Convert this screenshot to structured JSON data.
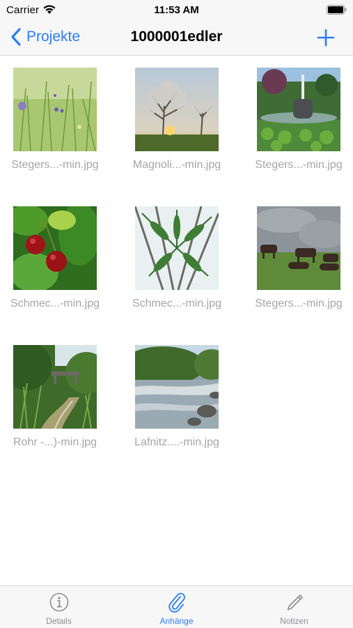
{
  "status_bar": {
    "carrier": "Carrier",
    "time": "11:53 AM"
  },
  "nav": {
    "back_label": "Projekte",
    "title": "1000001edler"
  },
  "attachments": [
    {
      "caption": "Stegers...-min.jpg",
      "image": "meadow-wildflowers"
    },
    {
      "caption": "Magnoli...-min.jpg",
      "image": "trees-sunset"
    },
    {
      "caption": "Stegers...-min.jpg",
      "image": "park-fountain-pond"
    },
    {
      "caption": "Schmec...-min.jpg",
      "image": "cherries"
    },
    {
      "caption": "Schmec...-min.jpg",
      "image": "fern-canopy"
    },
    {
      "caption": "Stegers...-min.jpg",
      "image": "cattle-pasture"
    },
    {
      "caption": "Rohr -...)-min.jpg",
      "image": "creek-bridge"
    },
    {
      "caption": "Lafnitz....-min.jpg",
      "image": "river-rapids"
    }
  ],
  "tabs": [
    {
      "label": "Details",
      "icon": "info-icon",
      "active": false
    },
    {
      "label": "Anhänge",
      "icon": "paperclip-icon",
      "active": true
    },
    {
      "label": "Notizen",
      "icon": "pencil-icon",
      "active": false
    }
  ],
  "colors": {
    "accent": "#2c7cf6",
    "caption": "#a5a5a5",
    "inactive_tab": "#8e8e93",
    "bar_background": "#f7f7f7"
  }
}
